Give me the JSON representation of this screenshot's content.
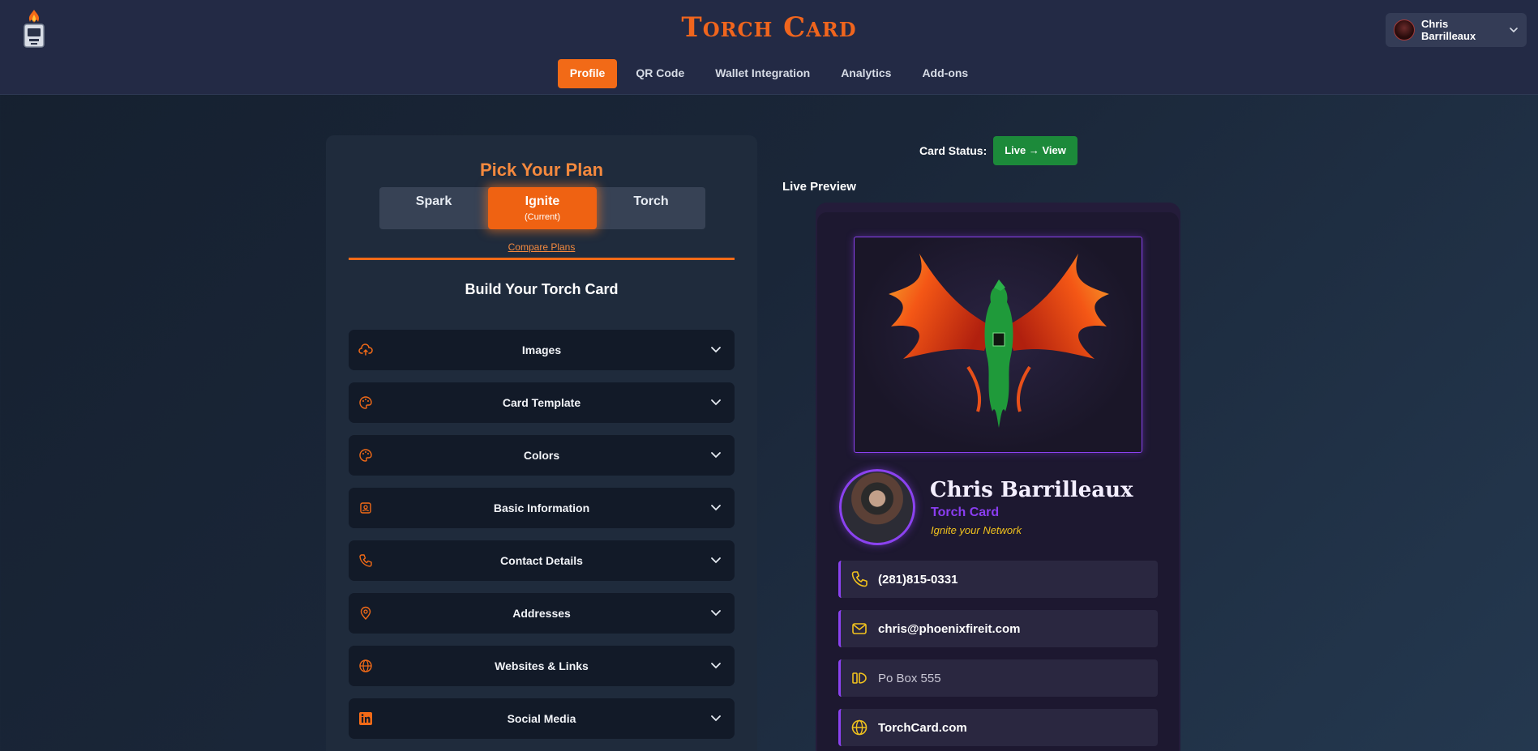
{
  "app": {
    "brand": "Torch Card"
  },
  "nav": [
    {
      "label": "Profile",
      "active": true
    },
    {
      "label": "QR Code",
      "active": false
    },
    {
      "label": "Wallet Integration",
      "active": false
    },
    {
      "label": "Analytics",
      "active": false
    },
    {
      "label": "Add-ons",
      "active": false
    }
  ],
  "user": {
    "name": "Chris Barrilleaux"
  },
  "plans": {
    "title": "Pick Your Plan",
    "tabs": [
      {
        "label": "Spark",
        "sub": ""
      },
      {
        "label": "Ignite",
        "sub": "(Current)"
      },
      {
        "label": "Torch",
        "sub": ""
      }
    ],
    "compare_link": "Compare Plans"
  },
  "builder": {
    "title": "Build Your Torch Card",
    "sections": [
      {
        "label": "Images",
        "icon": "cloud-upload-icon"
      },
      {
        "label": "Card Template",
        "icon": "palette-icon"
      },
      {
        "label": "Colors",
        "icon": "palette-icon"
      },
      {
        "label": "Basic Information",
        "icon": "id-card-icon"
      },
      {
        "label": "Contact Details",
        "icon": "phone-icon"
      },
      {
        "label": "Addresses",
        "icon": "map-pin-icon"
      },
      {
        "label": "Websites & Links",
        "icon": "globe-icon"
      },
      {
        "label": "Social Media",
        "icon": "linkedin-icon"
      }
    ]
  },
  "status": {
    "label": "Card Status:",
    "button": "Live → View"
  },
  "preview": {
    "label": "Live Preview",
    "name": "Chris Barrilleaux",
    "org": "Torch Card",
    "tagline": "Ignite your Network",
    "contacts": [
      {
        "icon": "phone-icon",
        "text": "(281)815-0331"
      },
      {
        "icon": "mail-icon",
        "text": "chris@phoenixfireit.com"
      },
      {
        "icon": "address-icon",
        "text": "Po Box 555"
      },
      {
        "icon": "globe-icon",
        "text": "TorchCard.com"
      }
    ]
  },
  "colors": {
    "accent": "#f26a17",
    "purple": "#8b42f0",
    "live_green": "#1c8a3a",
    "tagline_yellow": "#f1c21d"
  }
}
